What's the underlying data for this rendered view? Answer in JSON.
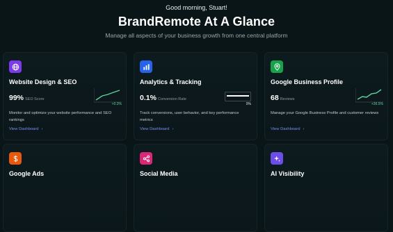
{
  "header": {
    "greeting": "Good morning, Stuart!",
    "title": "BrandRemote At A Glance",
    "subtitle": "Manage all aspects of your business growth from one central platform"
  },
  "cards": [
    {
      "title": "Website Design & SEO",
      "icon": "globe-icon",
      "icon_color": "#7c3aed",
      "metric_value": "99%",
      "metric_label": "SEO Score",
      "delta": "+0.3%",
      "description": "Monitor and optimize your website performance and SEO rankings",
      "link": "View Dashboard"
    },
    {
      "title": "Analytics & Tracking",
      "icon": "bar-chart-icon",
      "icon_color": "#2563eb",
      "metric_value": "0.1%",
      "metric_label": "Conversion Rate",
      "progress_label": "0%",
      "progress_fraction": 1.0,
      "description": "Track conversions, user behavior, and key performance metrics",
      "link": "View Dashboard"
    },
    {
      "title": "Google Business Profile",
      "icon": "map-pin-icon",
      "icon_color": "#16a34a",
      "metric_value": "68",
      "metric_label": "Reviews",
      "delta": "+36.5%",
      "description": "Manage your Google Business Profile and customer reviews",
      "link": "View Dashboard"
    },
    {
      "title": "Google Ads",
      "icon": "dollar-icon",
      "icon_color": "#ea580c"
    },
    {
      "title": "Social Media",
      "icon": "share-icon",
      "icon_color": "#db2777"
    },
    {
      "title": "AI Visibility",
      "icon": "sparkle-icon",
      "icon_color": "#6d4de8"
    }
  ],
  "colors": {
    "background": "#0a1518",
    "link": "#7d8cf5",
    "positive": "#5fd19a"
  }
}
